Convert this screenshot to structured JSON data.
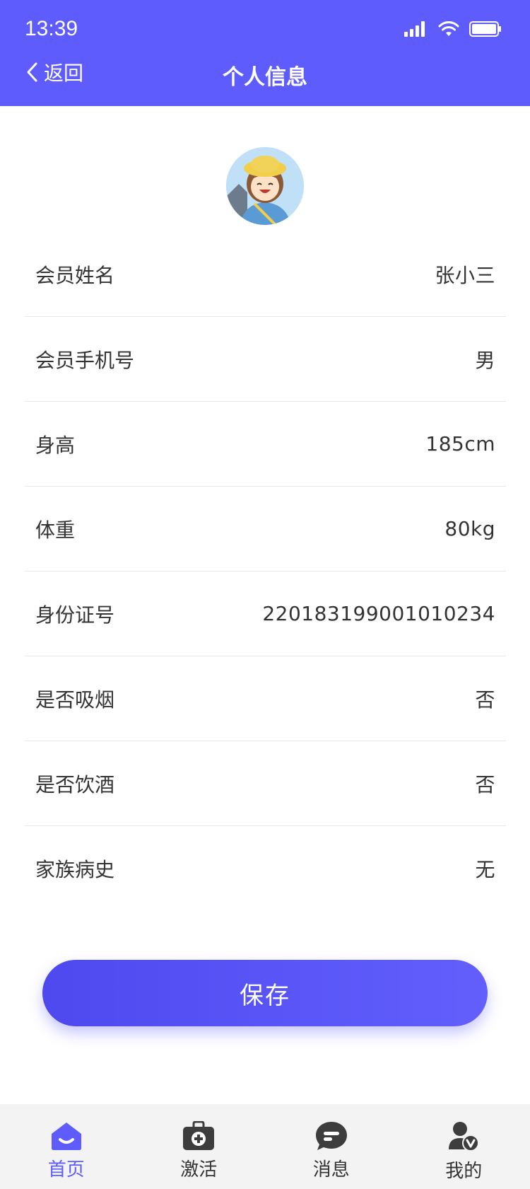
{
  "status_bar": {
    "time": "13:39"
  },
  "nav": {
    "back_label": "返回",
    "title": "个人信息"
  },
  "profile": {
    "rows": [
      {
        "label": "会员姓名",
        "value": "张小三"
      },
      {
        "label": "会员手机号",
        "value": "男"
      },
      {
        "label": "身高",
        "value": "185cm"
      },
      {
        "label": "体重",
        "value": "80kg"
      },
      {
        "label": "身份证号",
        "value": "220183199001010234"
      },
      {
        "label": "是否吸烟",
        "value": "否"
      },
      {
        "label": "是否饮酒",
        "value": "否"
      },
      {
        "label": "家族病史",
        "value": "无"
      }
    ]
  },
  "save_label": "保存",
  "tabbar": {
    "items": [
      {
        "label": "首页",
        "icon": "home-icon",
        "active": true
      },
      {
        "label": "激活",
        "icon": "medkit-icon",
        "active": false
      },
      {
        "label": "消息",
        "icon": "message-icon",
        "active": false
      },
      {
        "label": "我的",
        "icon": "user-verified-icon",
        "active": false
      }
    ]
  },
  "colors": {
    "brand": "#5f5cfd",
    "text": "#333333",
    "tab_bg": "#f3f3f3",
    "icon_gray": "#3d3d3d"
  }
}
